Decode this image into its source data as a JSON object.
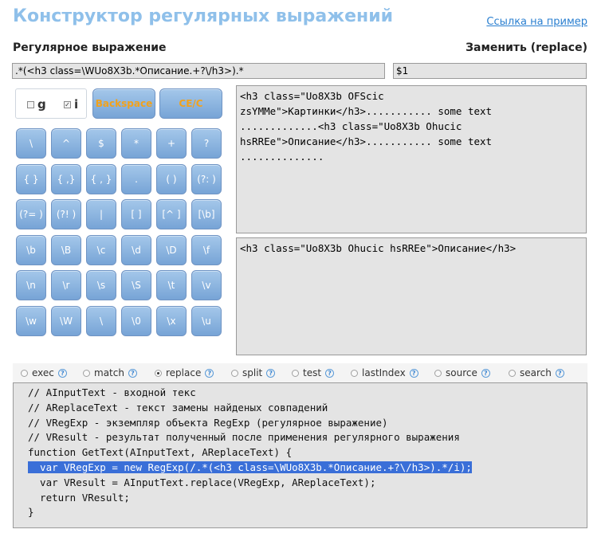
{
  "header": {
    "title": "Конструктор регулярных выражений",
    "example_link": "Ссылка на пример"
  },
  "labels": {
    "regex": "Регулярное выражение",
    "replace": "Заменить (replace)"
  },
  "inputs": {
    "regex_value": ".*(<h3 class=\\WUo8X3b.*Описание.+?\\/h3>).*",
    "replace_value": "$1"
  },
  "flags": [
    {
      "label": "g",
      "checked": false
    },
    {
      "label": "i",
      "checked": true
    }
  ],
  "actions": {
    "backspace": "Backspace",
    "clear": "CE/C"
  },
  "keypad": [
    [
      "\\",
      "^",
      "$",
      "*",
      "+",
      "?"
    ],
    [
      "{ }",
      "{ ,}",
      "{ , }",
      ".",
      "( )",
      "(?: )"
    ],
    [
      "(?= )",
      "(?! )",
      "|",
      "[ ]",
      "[^ ]",
      "[\\b]"
    ],
    [
      "\\b",
      "\\B",
      "\\c",
      "\\d",
      "\\D",
      "\\f"
    ],
    [
      "\\n",
      "\\r",
      "\\s",
      "\\S",
      "\\t",
      "\\v"
    ],
    [
      "\\w",
      "\\W",
      "\\",
      "\\0",
      "\\x",
      "\\u"
    ]
  ],
  "source_text": "<h3 class=\"Uo8X3b OFScic\nzsYMMe\">Картинки</h3>........... some text\n.............<h3 class=\"Uo8X3b Ohucic\nhsRREe\">Описание</h3>........... some text\n..............",
  "result_text": "<h3 class=\"Uo8X3b Ohucic hsRREe\">Описание</h3>",
  "methods": [
    {
      "label": "exec",
      "selected": false
    },
    {
      "label": "match",
      "selected": false
    },
    {
      "label": "replace",
      "selected": true
    },
    {
      "label": "split",
      "selected": false
    },
    {
      "label": "test",
      "selected": false
    },
    {
      "label": "lastIndex",
      "selected": false
    },
    {
      "label": "source",
      "selected": false
    },
    {
      "label": "search",
      "selected": false
    }
  ],
  "help_icon_glyph": "?",
  "code_lines": [
    "// AInputText - входной текс",
    "// AReplaceText - текст замены найденых совпадений",
    "// VRegExp - экземпляр объекта RegExp (регулярное выражение)",
    "// VResult - результат полученный после применения регулярного выражения",
    "function GetText(AInputText, AReplaceText) {",
    "  var VRegExp = new RegExp(/.*(<h3 class=\\WUo8X3b.*Описание.+?\\/h3>).*/i);",
    "  var VResult = AInputText.replace(VRegExp, AReplaceText);",
    "  return VResult;",
    "}"
  ],
  "highlighted_line_index": 5
}
